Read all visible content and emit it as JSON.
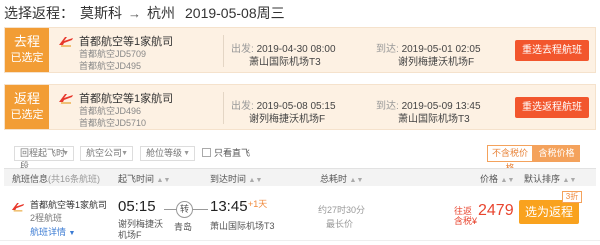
{
  "header": {
    "label": "选择返程：",
    "origin": "莫斯科",
    "destination": "杭州",
    "date": "2019-05-08周三"
  },
  "outbound": {
    "badge_title": "去程",
    "badge_status": "已选定",
    "airline": "首都航空等1家航司",
    "flight_1": "首都航空JD5709",
    "flight_2": "首都航空JD495",
    "dep_key": "出发:",
    "dep_time": "2019-04-30 08:00",
    "dep_airport": "萧山国际机场T3",
    "arr_key": "到达:",
    "arr_time": "2019-05-01 02:05",
    "arr_airport": "谢列梅捷沃机场F",
    "button": "重选去程航班"
  },
  "return": {
    "badge_title": "返程",
    "badge_status": "已选定",
    "airline": "首都航空等1家航司",
    "flight_1": "首都航空JD496",
    "flight_2": "首都航空JD5710",
    "dep_key": "出发:",
    "dep_time": "2019-05-08 05:15",
    "dep_airport": "谢列梅捷沃机场F",
    "arr_key": "到达:",
    "arr_time": "2019-05-09 13:45",
    "arr_airport": "萧山国际机场T3",
    "button": "重选返程航班"
  },
  "filters": {
    "depart_time": "回程起飞时段",
    "airline": "航空公司",
    "cabin": "舱位等级",
    "direct_only": "只看直飞",
    "tax_excl": "不含税价格",
    "tax_incl": "含税价格",
    "dropdown_icon": "chevron-down-icon"
  },
  "table_header": {
    "flight_info": "航班信息",
    "flight_count": "(共16条航班)",
    "dep_time": "起飞时间",
    "arr_time": "到达时间",
    "total": "总耗时",
    "price": "价格",
    "sort": "默认排序"
  },
  "result": {
    "airline": "首都航空等1家航司",
    "type": "2程航班",
    "detail": "航班详情",
    "dep_time": "05:15",
    "dep_airport": "谢列梅捷沃机场F",
    "stop_badge": "转",
    "stop_city": "青岛",
    "arr_time": "13:45",
    "day_plus": "+1天",
    "arr_airport": "萧山国际机场T3",
    "duration": "约27时30分",
    "ontime": "最长价",
    "price_label_1": "往返",
    "price_label_2": "含税¥",
    "price": "2479",
    "book_button": "选为返程",
    "discount": "3折"
  },
  "colors": {
    "accent_orange": "#f29d35",
    "red_button": "#f2562d",
    "price_red": "#e8452f",
    "book_yellow": "#f9a21e"
  }
}
